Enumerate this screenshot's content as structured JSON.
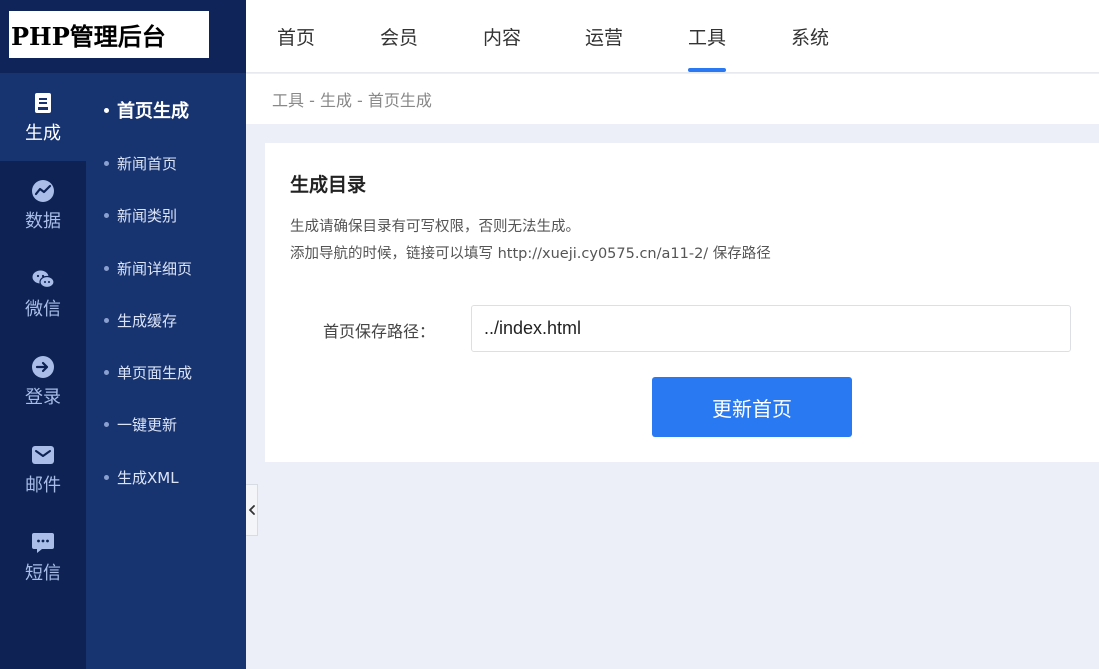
{
  "logo": {
    "text": "PHP管理后台"
  },
  "topnav": {
    "items": [
      {
        "label": "首页"
      },
      {
        "label": "会员"
      },
      {
        "label": "内容"
      },
      {
        "label": "运营"
      },
      {
        "label": "工具"
      },
      {
        "label": "系统"
      }
    ],
    "active": "工具"
  },
  "iconnav": {
    "items": [
      {
        "label": "生成",
        "icon": "document-icon"
      },
      {
        "label": "数据",
        "icon": "chart-icon"
      },
      {
        "label": "微信",
        "icon": "wechat-icon"
      },
      {
        "label": "登录",
        "icon": "login-arrow-icon"
      },
      {
        "label": "邮件",
        "icon": "mail-icon"
      },
      {
        "label": "短信",
        "icon": "message-icon"
      }
    ],
    "active": "生成"
  },
  "submenu": {
    "items": [
      {
        "label": "首页生成"
      },
      {
        "label": "新闻首页"
      },
      {
        "label": "新闻类别"
      },
      {
        "label": "新闻详细页"
      },
      {
        "label": "生成缓存"
      },
      {
        "label": "单页面生成"
      },
      {
        "label": "一键更新"
      },
      {
        "label": "生成XML"
      }
    ],
    "active": "首页生成"
  },
  "breadcrumb": {
    "text": "工具 - 生成 - 首页生成"
  },
  "card": {
    "title": "生成目录",
    "desc_line1": "生成请确保目录有可写权限，否则无法生成。",
    "desc_line2": "添加导航的时候，链接可以填写 http://xueji.cy0575.cn/a11-2/ 保存路径",
    "path_label": "首页保存路径：",
    "path_value": "../index.html",
    "submit_label": "更新首页"
  },
  "colors": {
    "accent": "#2979f3",
    "sidebar_dark": "#0e2253",
    "sidebar_mid": "#183470"
  }
}
